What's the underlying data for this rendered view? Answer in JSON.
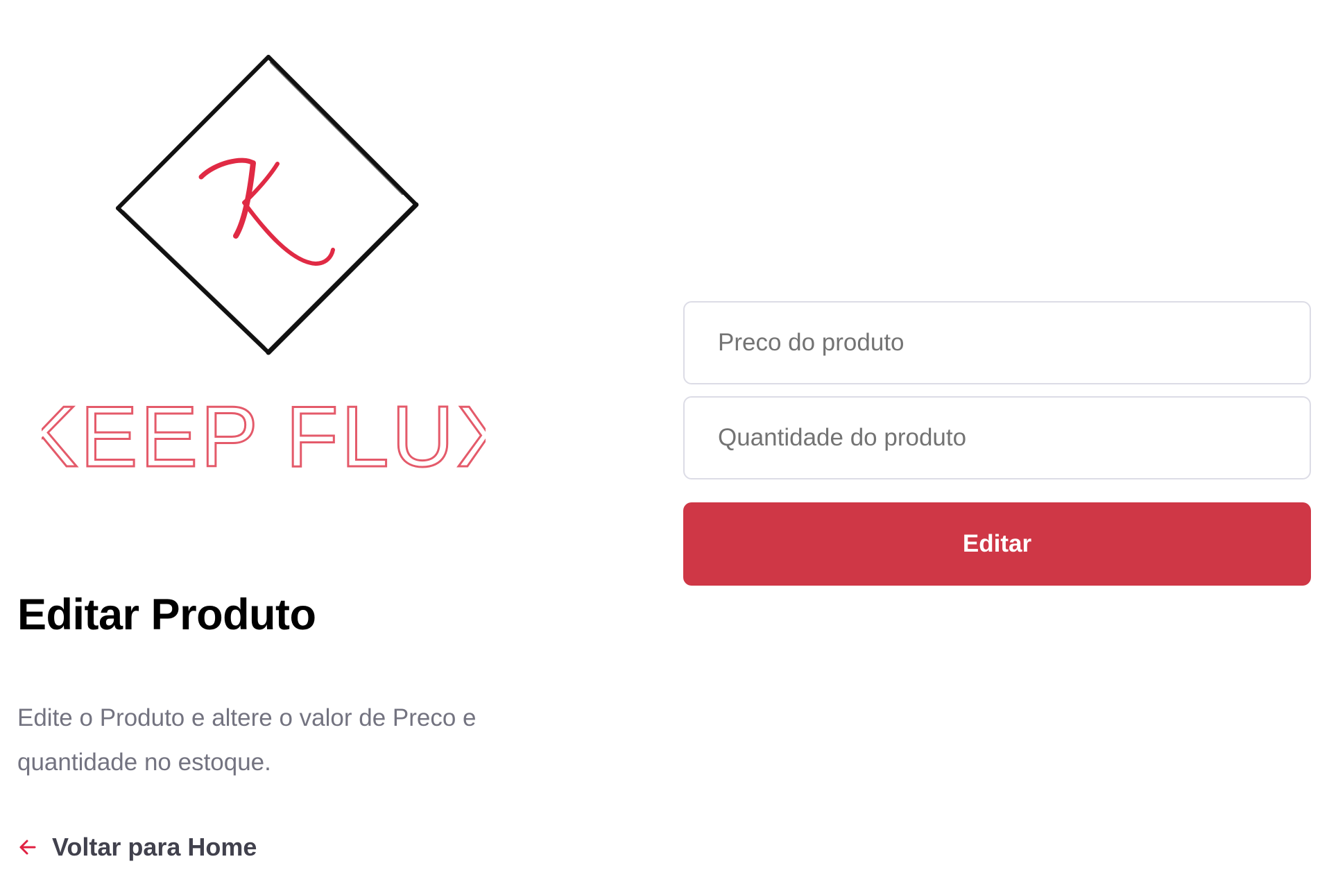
{
  "brand": {
    "logo_initial": "K",
    "logo_text": "KEEP FLUX",
    "logo_text_color": "#e45a6a",
    "logo_frame_color": "#111111"
  },
  "page": {
    "title": "Editar Produto",
    "description": "Edite o Produto e altere o valor de Preco e quantidade no estoque.",
    "back_link_label": "Voltar para Home",
    "back_icon": "arrow-left-icon"
  },
  "form": {
    "price_field": {
      "placeholder": "Preco do produto",
      "value": ""
    },
    "quantity_field": {
      "placeholder": "Quantidade do produto",
      "value": ""
    },
    "submit_label": "Editar"
  },
  "colors": {
    "accent": "#cf3746",
    "title": "#000000",
    "muted_text": "#737380",
    "link_text": "#41414d",
    "input_border": "#dcdce6"
  }
}
